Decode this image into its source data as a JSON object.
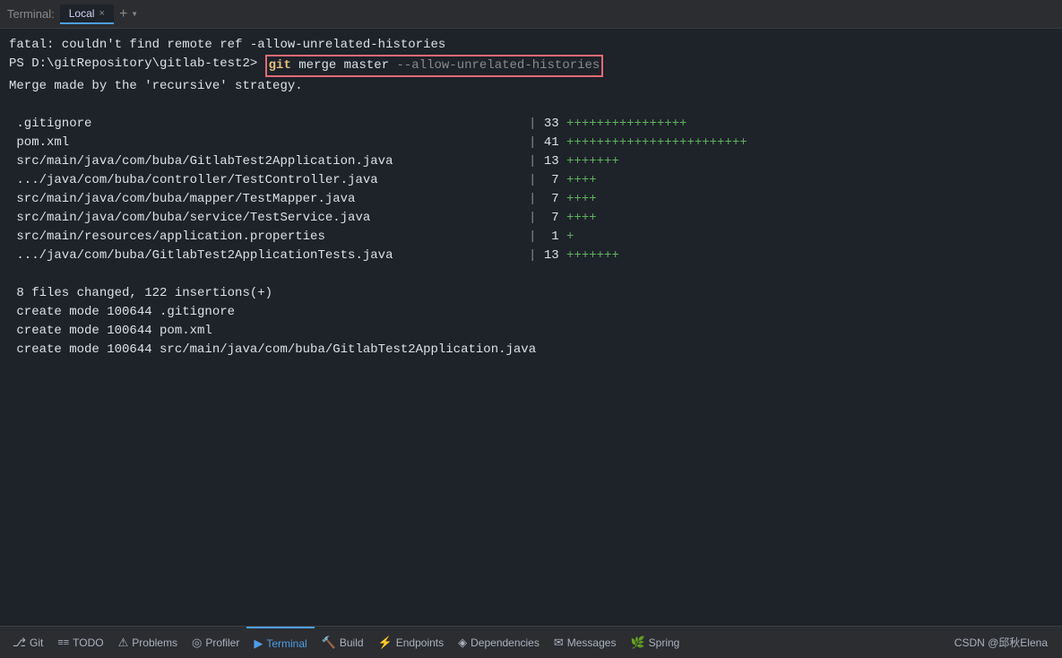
{
  "tabbar": {
    "label": "Terminal:",
    "tab_name": "Local",
    "add_icon": "+",
    "dropdown_icon": "▾"
  },
  "terminal": {
    "lines": [
      {
        "type": "plain",
        "text": "fatal: couldn't find remote ref -allow-unrelated-histories",
        "color": "white"
      },
      {
        "type": "prompt",
        "prompt": "PS D:\\gitRepository\\gitlab-test2>",
        "command_highlighted": true,
        "command_git": "git",
        "command_rest": " merge master",
        "command_tail": " --allow-unrelated-histories"
      },
      {
        "type": "plain",
        "text": "Merge made by the 'recursive' strategy.",
        "color": "white"
      },
      {
        "type": "blank"
      },
      {
        "type": "diff",
        "file": " .gitignore",
        "num": "33",
        "plusses": "++++++++++++++++"
      },
      {
        "type": "diff",
        "file": " pom.xml",
        "num": "41",
        "plusses": "++++++++++++++++++++++++"
      },
      {
        "type": "diff",
        "file": " src/main/java/com/buba/GitlabTest2Application.java",
        "num": "13",
        "plusses": "+++++++"
      },
      {
        "type": "diff",
        "file": " .../java/com/buba/controller/TestController.java",
        "num": " 7",
        "plusses": "++++"
      },
      {
        "type": "diff",
        "file": " src/main/java/com/buba/mapper/TestMapper.java",
        "num": " 7",
        "plusses": "++++"
      },
      {
        "type": "diff",
        "file": " src/main/java/com/buba/service/TestService.java",
        "num": " 7",
        "plusses": "++++"
      },
      {
        "type": "diff",
        "file": " src/main/resources/application.properties",
        "num": " 1",
        "plusses": "+"
      },
      {
        "type": "diff",
        "file": " .../java/com/buba/GitlabTest2ApplicationTests.java",
        "num": "13",
        "plusses": "+++++++"
      },
      {
        "type": "blank"
      },
      {
        "type": "plain",
        "text": " 8 files changed, 122 insertions(+)",
        "color": "white"
      },
      {
        "type": "plain",
        "text": " create mode 100644 .gitignore",
        "color": "white"
      },
      {
        "type": "plain",
        "text": " create mode 100644 pom.xml",
        "color": "white"
      },
      {
        "type": "plain",
        "text": " create mode 100644 src/main/java/com/buba/GitlabTest2Application.java",
        "color": "white"
      }
    ]
  },
  "statusbar": {
    "items": [
      {
        "icon": "⎇",
        "label": "Git",
        "name": "git-status"
      },
      {
        "icon": "≡",
        "label": "TODO",
        "name": "todo-status"
      },
      {
        "icon": "⚠",
        "label": "Problems",
        "name": "problems-status"
      },
      {
        "icon": "◎",
        "label": "Profiler",
        "name": "profiler-status"
      },
      {
        "icon": "▶",
        "label": "Terminal",
        "name": "terminal-status",
        "active": true
      },
      {
        "icon": "🔨",
        "label": "Build",
        "name": "build-status"
      },
      {
        "icon": "⚡",
        "label": "Endpoints",
        "name": "endpoints-status"
      },
      {
        "icon": "◈",
        "label": "Dependencies",
        "name": "dependencies-status"
      },
      {
        "icon": "✉",
        "label": "Messages",
        "name": "messages-status"
      },
      {
        "icon": "🌿",
        "label": "Spring",
        "name": "spring-status"
      }
    ],
    "right_text": "CSDN @邱秋Elena"
  }
}
